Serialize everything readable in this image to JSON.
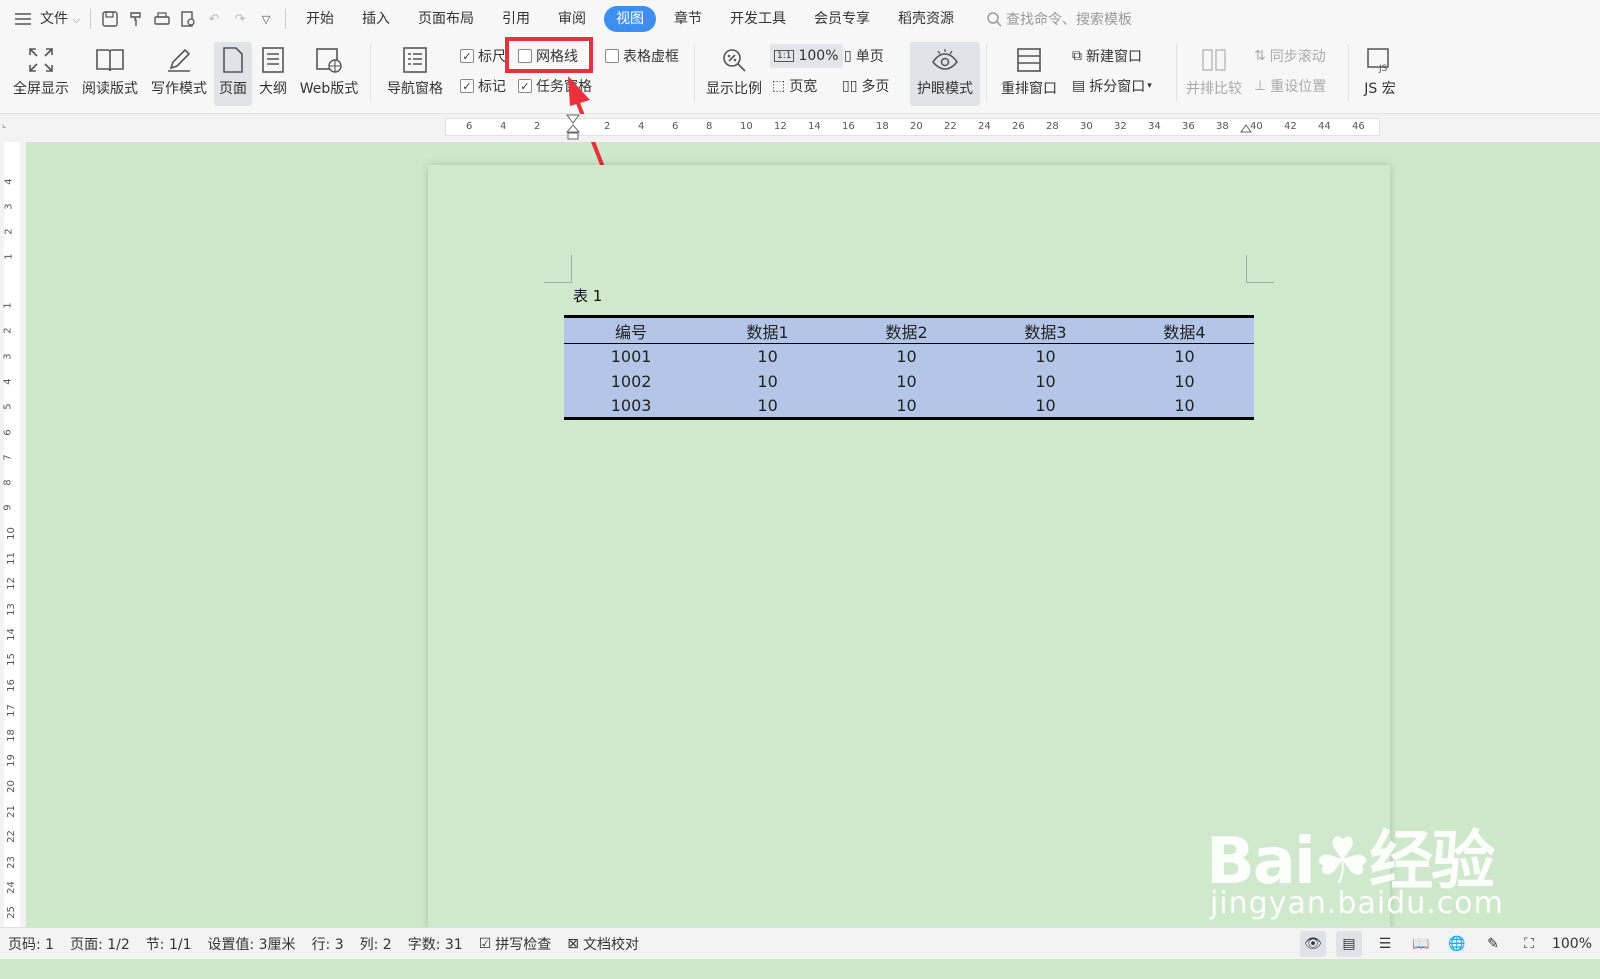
{
  "menu": {
    "file_label": "文件",
    "tabs": [
      "开始",
      "插入",
      "页面布局",
      "引用",
      "审阅",
      "视图",
      "章节",
      "开发工具",
      "会员专享",
      "稻壳资源"
    ],
    "active_tab": "视图",
    "search_placeholder": "查找命令、搜索模板"
  },
  "ribbon": {
    "fullscreen": "全屏显示",
    "read_mode": "阅读版式",
    "write_mode": "写作模式",
    "page_view": "页面",
    "outline": "大纲",
    "web_view": "Web版式",
    "nav_pane": "导航窗格",
    "ruler": "标尺",
    "gridlines": "网格线",
    "table_dashed": "表格虚框",
    "marks": "标记",
    "task_pane": "任务窗格",
    "zoom_ratio": "显示比例",
    "zoom_100": "100%",
    "page_width": "页宽",
    "single_page": "单页",
    "multi_page": "多页",
    "eye_protect": "护眼模式",
    "rearrange": "重排窗口",
    "new_window": "新建窗口",
    "split_window": "拆分窗口",
    "side_by_side": "并排比较",
    "sync_scroll": "同步滚动",
    "reset_position": "重设位置",
    "js_macro": "JS 宏",
    "checked": {
      "ruler": true,
      "gridlines": false,
      "table_dashed": false,
      "marks": true,
      "task_pane": true
    }
  },
  "ruler": {
    "h_ticks": [
      "6",
      "4",
      "2",
      "2",
      "4",
      "6",
      "8",
      "10",
      "12",
      "14",
      "16",
      "18",
      "20",
      "22",
      "24",
      "26",
      "28",
      "30",
      "32",
      "34",
      "36",
      "38",
      "40",
      "42",
      "44",
      "46"
    ],
    "v_ticks_top": [
      "4",
      "3",
      "2",
      "1"
    ],
    "v_ticks": [
      "1",
      "2",
      "3",
      "4",
      "5",
      "6",
      "7",
      "8",
      "9",
      "10",
      "11",
      "12",
      "13",
      "14",
      "15",
      "16",
      "17",
      "18",
      "19",
      "20",
      "21",
      "22",
      "23",
      "24",
      "25"
    ]
  },
  "document": {
    "caption": "表 1",
    "headers": [
      "编号",
      "数据1",
      "数据2",
      "数据3",
      "数据4"
    ],
    "rows": [
      [
        "1001",
        "10",
        "10",
        "10",
        "10"
      ],
      [
        "1002",
        "10",
        "10",
        "10",
        "10"
      ],
      [
        "1003",
        "10",
        "10",
        "10",
        "10"
      ]
    ],
    "table_bg": "#b4c6e7",
    "page_bg": "#d0e8cd"
  },
  "watermark": {
    "logo": "Baidu经验",
    "url": "jingyan.baidu.com"
  },
  "status": {
    "page_code": "页码: 1",
    "pages": "页面: 1/2",
    "section": "节: 1/1",
    "setting": "设置值: 3厘米",
    "row": "行: 3",
    "col": "列: 2",
    "word_count": "字数: 31",
    "spell_check": "拼写检查",
    "doc_proof": "文档校对",
    "zoom": "100%"
  },
  "colors": {
    "accent": "#3c8ef0",
    "highlight_box": "#e8313b"
  }
}
